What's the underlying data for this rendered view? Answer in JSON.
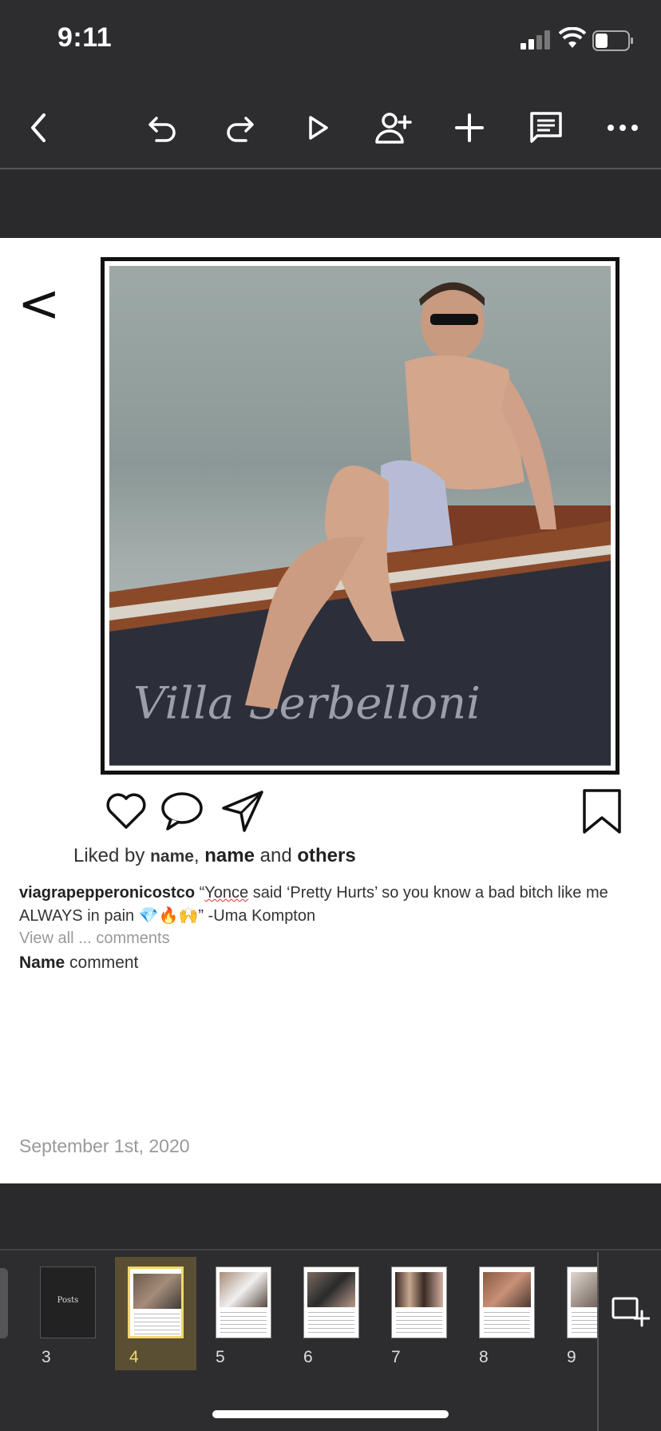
{
  "status": {
    "time": "9:11"
  },
  "toolbar": {
    "buttons": [
      "back-icon",
      "undo-icon",
      "redo-icon",
      "play-icon",
      "add-person-icon",
      "plus-icon",
      "comment-icon",
      "more-icon"
    ]
  },
  "slide": {
    "prev_arrow": "<",
    "liked_prefix": "Liked by ",
    "liked_name1": "name",
    "liked_sep": ", ",
    "liked_name2": "name",
    "liked_and": " and ",
    "liked_others": "others",
    "caption_user": "viagrapepperonicostco",
    "caption_open": " “",
    "caption_squig": "Yonce",
    "caption_text": " said ‘Pretty Hurts’ so you know a bad bitch like me ALWAYS in pain 💎🔥🙌” -Uma Kompton",
    "view_all": "View all ... comments",
    "comment_name": "Name",
    "comment_text": " comment",
    "date": "September 1st, 2020"
  },
  "thumbnails": {
    "items": [
      {
        "num": "3",
        "title": "Posts"
      },
      {
        "num": "4",
        "title": ""
      },
      {
        "num": "5",
        "title": ""
      },
      {
        "num": "6",
        "title": ""
      },
      {
        "num": "7",
        "title": ""
      },
      {
        "num": "8",
        "title": ""
      },
      {
        "num": "9",
        "title": ""
      }
    ],
    "selected": "4"
  },
  "colors": {
    "selected_accent": "#f2d76a",
    "background": "#2d2d30"
  }
}
